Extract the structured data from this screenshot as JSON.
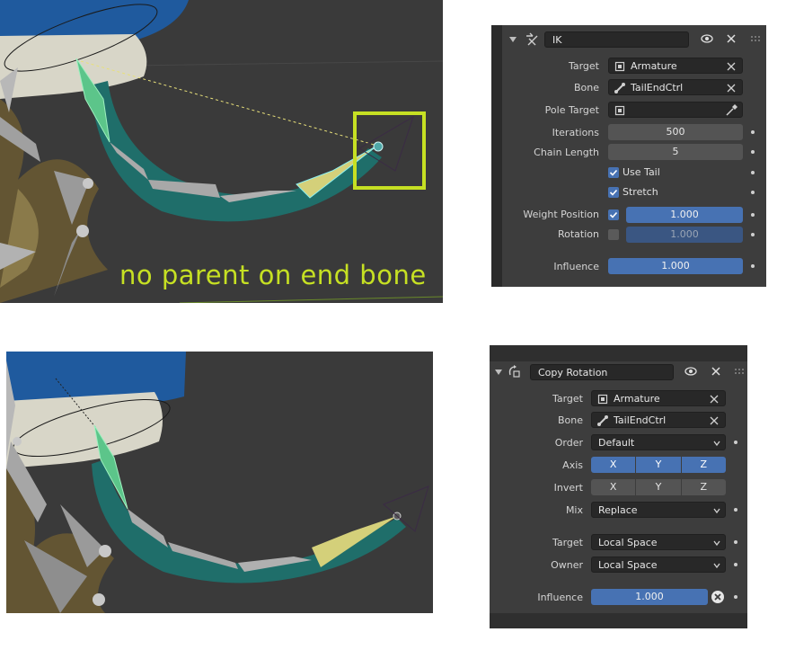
{
  "viewport_top": {
    "caption": "no parent on end bone"
  },
  "ik_panel": {
    "constraint_name": "IK",
    "rows": {
      "target": {
        "label": "Target",
        "value": "Armature"
      },
      "bone": {
        "label": "Bone",
        "value": "TailEndCtrl"
      },
      "pole_target": {
        "label": "Pole Target",
        "value": ""
      },
      "iterations": {
        "label": "Iterations",
        "value": "500"
      },
      "chain_length": {
        "label": "Chain Length",
        "value": "5"
      },
      "use_tail": {
        "label": "Use Tail",
        "checked": true
      },
      "stretch": {
        "label": "Stretch",
        "checked": true
      },
      "weight_position": {
        "label": "Weight Position",
        "checked": true,
        "value": "1.000"
      },
      "rotation": {
        "label": "Rotation",
        "checked": false,
        "value": "1.000"
      },
      "influence": {
        "label": "Influence",
        "value": "1.000"
      }
    }
  },
  "copyrot_panel": {
    "constraint_name": "Copy Rotation",
    "rows": {
      "target": {
        "label": "Target",
        "value": "Armature"
      },
      "bone": {
        "label": "Bone",
        "value": "TailEndCtrl"
      },
      "order": {
        "label": "Order",
        "value": "Default"
      },
      "axis": {
        "label": "Axis",
        "x": "X",
        "y": "Y",
        "z": "Z"
      },
      "invert": {
        "label": "Invert",
        "x": "X",
        "y": "Y",
        "z": "Z"
      },
      "mix": {
        "label": "Mix",
        "value": "Replace"
      },
      "target_space": {
        "label": "Target",
        "value": "Local Space"
      },
      "owner_space": {
        "label": "Owner",
        "value": "Local Space"
      },
      "influence": {
        "label": "Influence",
        "value": "1.000"
      }
    }
  },
  "colors": {
    "accent_blue": "#4772b3",
    "panel_bg": "#3d3d3d",
    "field_dark": "#282828",
    "highlight_green": "#c6e023"
  }
}
